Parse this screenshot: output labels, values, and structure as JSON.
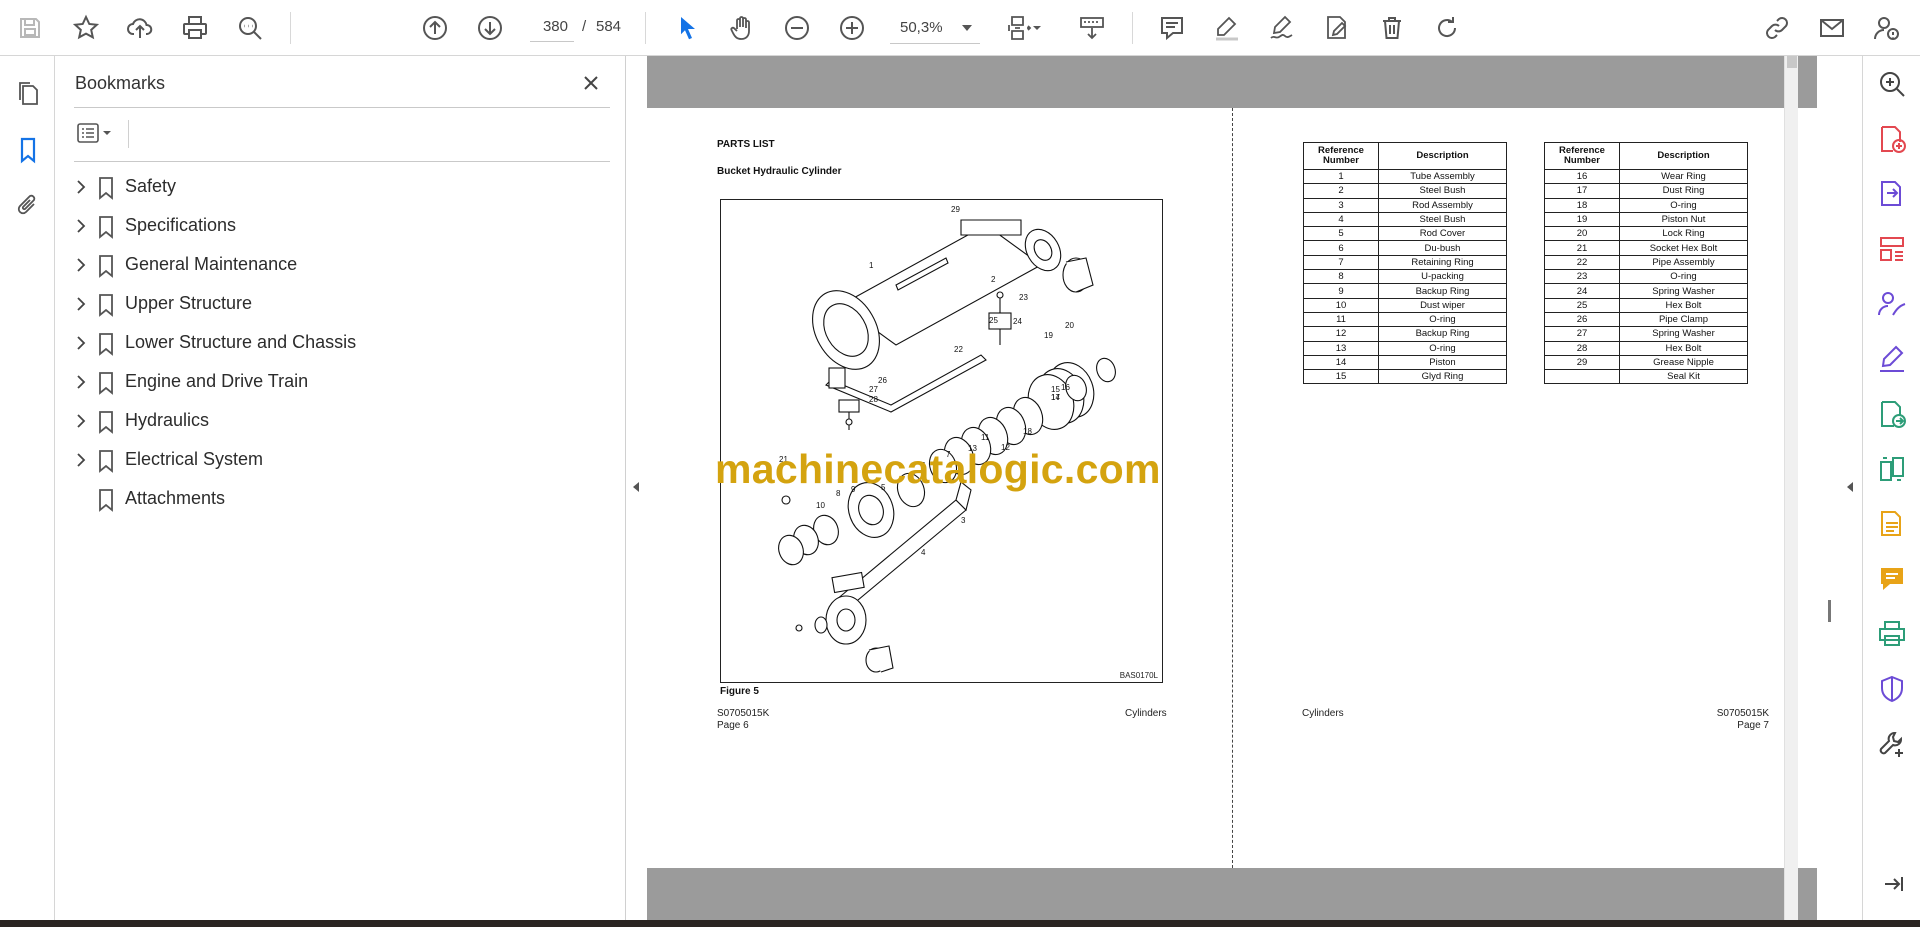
{
  "toolbar": {
    "current_page": "380",
    "page_separator": "/",
    "total_pages": "584",
    "zoom": "50,3%"
  },
  "bookmarks": {
    "title": "Bookmarks",
    "items": [
      {
        "label": "Safety",
        "expandable": true
      },
      {
        "label": "Specifications",
        "expandable": true
      },
      {
        "label": "General Maintenance",
        "expandable": true
      },
      {
        "label": "Upper Structure",
        "expandable": true
      },
      {
        "label": "Lower Structure and Chassis",
        "expandable": true
      },
      {
        "label": "Engine and Drive Train",
        "expandable": true
      },
      {
        "label": "Hydraulics",
        "expandable": true
      },
      {
        "label": "Electrical System",
        "expandable": true
      },
      {
        "label": "Attachments",
        "expandable": false
      }
    ]
  },
  "document": {
    "heading": "PARTS LIST",
    "subheading": "Bucket Hydraulic Cylinder",
    "figure_code": "BAS0170L",
    "figure_caption": "Figure 5",
    "watermark": "machinecatalogic.com",
    "left_footer": {
      "doc_id": "S0705015K",
      "page": "Page 6",
      "section": "Cylinders"
    },
    "right_footer": {
      "doc_id": "S0705015K",
      "page": "Page 7",
      "section": "Cylinders"
    },
    "table_headers": {
      "ref_line1": "Reference",
      "ref_line2": "Number",
      "desc": "Description"
    },
    "table1": [
      [
        "1",
        "Tube Assembly"
      ],
      [
        "2",
        "Steel Bush"
      ],
      [
        "3",
        "Rod Assembly"
      ],
      [
        "4",
        "Steel Bush"
      ],
      [
        "5",
        "Rod Cover"
      ],
      [
        "6",
        "Du-bush"
      ],
      [
        "7",
        "Retaining Ring"
      ],
      [
        "8",
        "U-packing"
      ],
      [
        "9",
        "Backup Ring"
      ],
      [
        "10",
        "Dust wiper"
      ],
      [
        "11",
        "O-ring"
      ],
      [
        "12",
        "Backup Ring"
      ],
      [
        "13",
        "O-ring"
      ],
      [
        "14",
        "Piston"
      ],
      [
        "15",
        "Glyd Ring"
      ]
    ],
    "table2": [
      [
        "16",
        "Wear Ring"
      ],
      [
        "17",
        "Dust Ring"
      ],
      [
        "18",
        "O-ring"
      ],
      [
        "19",
        "Piston Nut"
      ],
      [
        "20",
        "Lock Ring"
      ],
      [
        "21",
        "Socket Hex Bolt"
      ],
      [
        "22",
        "Pipe Assembly"
      ],
      [
        "23",
        "O-ring"
      ],
      [
        "24",
        "Spring Washer"
      ],
      [
        "25",
        "Hex Bolt"
      ],
      [
        "26",
        "Pipe Clamp"
      ],
      [
        "27",
        "Spring Washer"
      ],
      [
        "28",
        "Hex Bolt"
      ],
      [
        "29",
        "Grease Nipple"
      ]
    ],
    "table2_last_extra": "Seal Kit",
    "callouts": [
      "1",
      "2",
      "3",
      "4",
      "5",
      "6",
      "7",
      "8",
      "9",
      "10",
      "11",
      "12",
      "13",
      "14",
      "15",
      "16",
      "17",
      "18",
      "19",
      "20",
      "21",
      "22",
      "23",
      "24",
      "25",
      "26",
      "27",
      "28",
      "29"
    ]
  },
  "colors": {
    "accent_blue": "#1473e6",
    "rail_purple": "#6c4bd6",
    "rail_red": "#e34850",
    "rail_yellow": "#e8a317",
    "rail_green": "#2d9d78",
    "watermark": "#d4a30f"
  }
}
